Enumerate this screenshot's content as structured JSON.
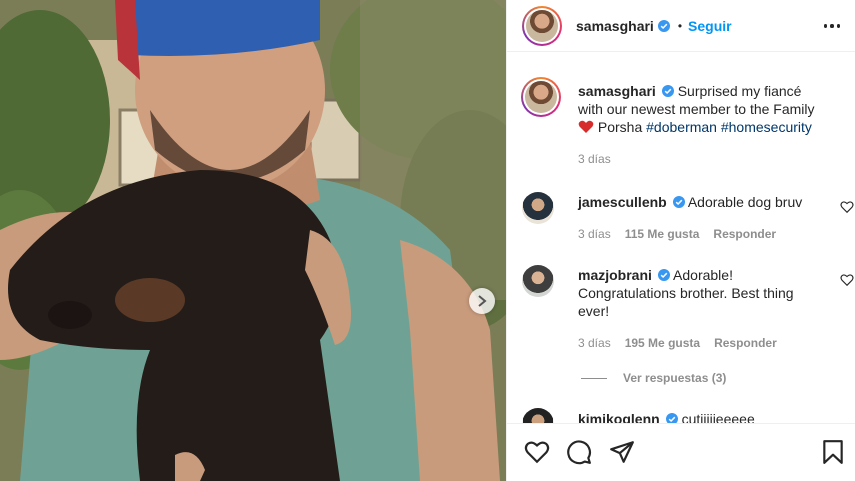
{
  "post": {
    "username": "samasghari",
    "follow_label": "Seguir",
    "dot": "•",
    "caption": {
      "text": "Surprised my fiancé with our newest member to the Family",
      "emoji": "❤️",
      "name": "Porsha",
      "hashtags": [
        "#doberman",
        "#homesecurity"
      ]
    },
    "time": "3 días"
  },
  "comments": [
    {
      "username": "jamescullenb",
      "text": "Adorable dog bruv",
      "time": "3 días",
      "likes": "115 Me gusta",
      "reply_label": "Responder"
    },
    {
      "username": "mazjobrani",
      "text": "Adorable! Congratulations brother. Best thing ever!",
      "time": "3 días",
      "likes": "195 Me gusta",
      "reply_label": "Responder",
      "view_replies": "Ver respuestas (3)"
    },
    {
      "username": "kimikoglenn",
      "text": "cutiiiiieeeee"
    }
  ],
  "icons": {
    "verified": "verified-badge-icon",
    "more": "more-options-icon",
    "heart": "heart-icon",
    "comment": "comment-icon",
    "share": "share-icon",
    "save": "bookmark-icon",
    "next": "chevron-right-icon"
  },
  "colors": {
    "accent": "#0095f6",
    "hashtag": "#00376b",
    "heart": "#ed4956",
    "muted": "#8e8e8e"
  }
}
